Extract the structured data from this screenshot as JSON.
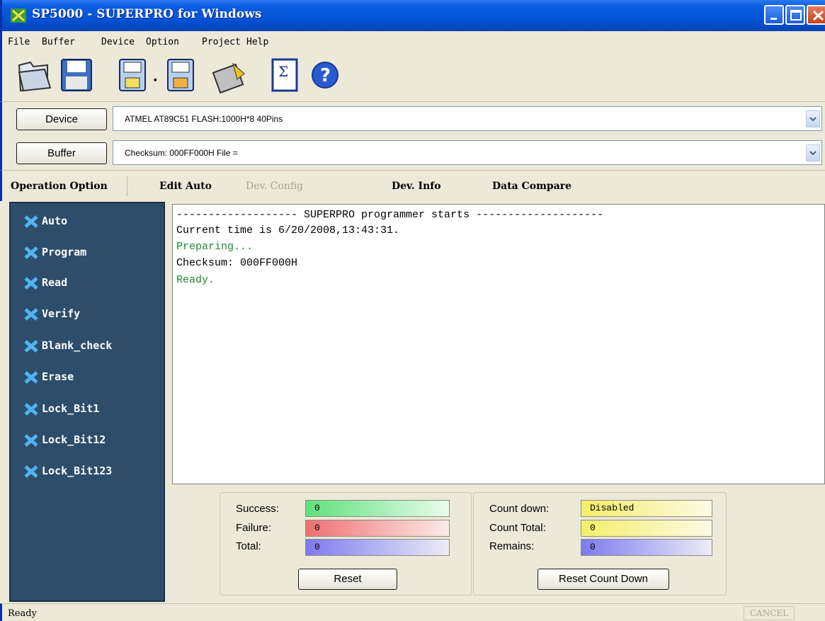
{
  "window": {
    "title": "SP5000 - SUPERPRO for Windows",
    "colors": {
      "titlebar": "#0553d6",
      "panel": "#2e4d6a"
    }
  },
  "menu": [
    "File",
    "Buffer",
    "Device",
    "Option",
    "Project",
    "Help"
  ],
  "toolbar": {
    "icons": [
      "open-folder-icon",
      "save-disk-icon",
      "load-chip-icon",
      "save-chip-icon",
      "auto-program-icon",
      "checksum-sigma-icon",
      "help-icon"
    ]
  },
  "device": {
    "button_label": "Device",
    "value": "ATMEL  AT89C51  FLASH:1000H*8  40Pins"
  },
  "buffer": {
    "button_label": "Buffer",
    "value": "Checksum: 000FF000H    File ="
  },
  "tabs": [
    {
      "label": "Operation Option",
      "enabled": true
    },
    {
      "label": "Edit Auto",
      "enabled": true
    },
    {
      "label": "Dev. Config",
      "enabled": false
    },
    {
      "label": "Dev. Info",
      "enabled": true
    },
    {
      "label": "Data Compare",
      "enabled": true
    }
  ],
  "operations": [
    "Auto",
    "Program",
    "Read",
    "Verify",
    "Blank_check",
    "Erase",
    "Lock_Bit1",
    "Lock_Bit12",
    "Lock_Bit123"
  ],
  "log": [
    {
      "text": "------------------- SUPERPRO programmer starts --------------------",
      "color": "black"
    },
    {
      "text": "Current time is 6/20/2008,13:43:31.",
      "color": "black"
    },
    {
      "text": "Preparing...",
      "color": "green"
    },
    {
      "text": "Checksum: 000FF000H",
      "color": "black"
    },
    {
      "text": "Ready.",
      "color": "green"
    }
  ],
  "stats": {
    "success_label": "Success:",
    "success": "0",
    "failure_label": "Failure:",
    "failure": "0",
    "total_label": "Total:",
    "total": "0",
    "reset_label": "Reset"
  },
  "countdown": {
    "countdown_label": "Count down:",
    "countdown": "Disabled",
    "count_total_label": "Count Total:",
    "count_total": "0",
    "remains_label": "Remains:",
    "remains": "0",
    "reset_label": "Reset Count Down"
  },
  "status": {
    "text": "Ready",
    "cancel_label": "CANCEL"
  }
}
